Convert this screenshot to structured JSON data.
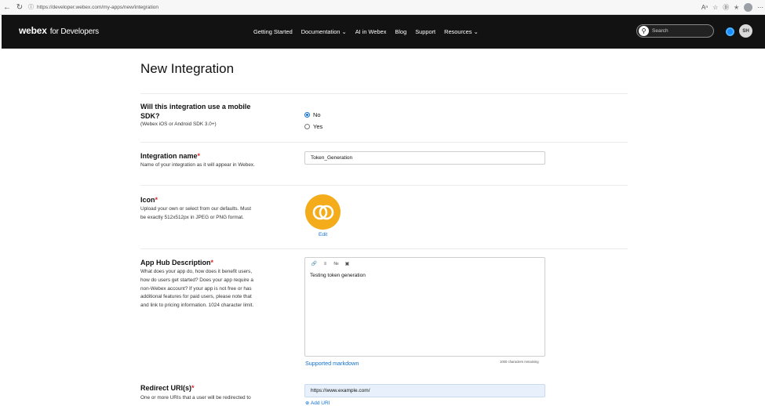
{
  "browser": {
    "url": "https://developer.webex.com/my-apps/new/integration",
    "back_icon": "arrow-left-icon",
    "refresh_icon": "refresh-icon"
  },
  "header": {
    "logo_main": "webex",
    "logo_sub": "for Developers",
    "nav": [
      "Getting Started",
      "Documentation",
      "AI in Webex",
      "Blog",
      "Support",
      "Resources"
    ],
    "search_placeholder": "Search",
    "avatar_initials": "SH"
  },
  "page": {
    "title": "New Integration"
  },
  "mobile_sdk": {
    "label": "Will this integration use a mobile SDK?",
    "note": "(Webex iOS or Android SDK 3.0+)",
    "options": [
      "No",
      "Yes"
    ],
    "selected": "No"
  },
  "integration_name": {
    "label": "Integration name",
    "required_mark": "*",
    "desc": "Name of your integration as it will appear in Webex.",
    "value": "Token_Generation"
  },
  "icon": {
    "label": "Icon",
    "required_mark": "*",
    "desc": "Upload your own or select from our defaults. Must be exactly 512x512px in JPEG or PNG format.",
    "edit_label": "Edit",
    "icon_color": "#f4ac1a"
  },
  "description": {
    "label": "App Hub Description",
    "required_mark": "*",
    "desc": "What does your app do, how does it benefit users, how do users get started? Does your app require a non-Webex account? If your app is not free or has additional features for paid users, please note that and link to pricing information. 1024 character limit.",
    "content": "Testing token generation",
    "markdown_link": "Supported markdown",
    "remaining": "1000 characters remaining"
  },
  "redirect": {
    "label": "Redirect URI(s)",
    "required_mark": "*",
    "desc": "One or more URIs that a user will be redirected to",
    "value": "https://www.example.com/",
    "add_label": "Add URI"
  },
  "colors": {
    "accent": "#1170cf",
    "header_bg": "#121212",
    "required": "#d42a2a"
  }
}
